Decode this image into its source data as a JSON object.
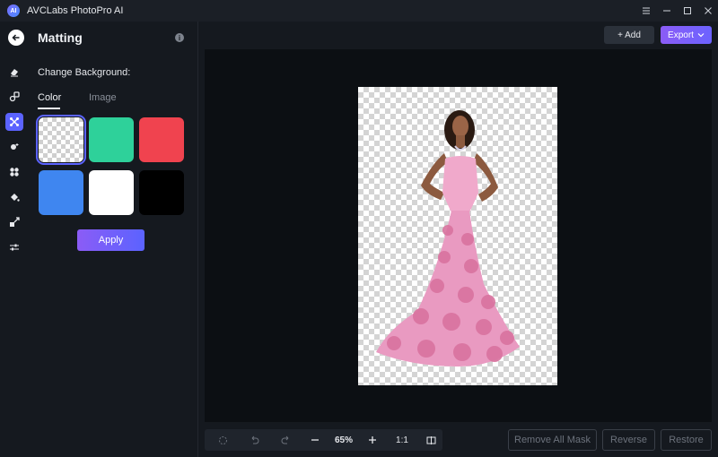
{
  "app": {
    "title": "AVCLabs PhotoPro AI",
    "logo_text": "AI"
  },
  "window_controls": [
    "menu-icon",
    "minimize-icon",
    "maximize-icon",
    "close-icon"
  ],
  "panel": {
    "title": "Matting",
    "info": "i",
    "change_bg_label": "Change Background:",
    "tabs": [
      {
        "label": "Color",
        "active": true
      },
      {
        "label": "Image",
        "active": false
      }
    ],
    "swatches": [
      {
        "name": "transparent",
        "color": "transparent",
        "selected": true
      },
      {
        "name": "green",
        "color": "#2ed19a",
        "selected": false
      },
      {
        "name": "red",
        "color": "#f0434f",
        "selected": false
      },
      {
        "name": "blue",
        "color": "#3f86f0",
        "selected": false
      },
      {
        "name": "white",
        "color": "#ffffff",
        "selected": false
      },
      {
        "name": "black",
        "color": "#000000",
        "selected": false
      }
    ],
    "apply_label": "Apply"
  },
  "rail": {
    "items": [
      "eraser-icon",
      "retouch-icon",
      "matting-icon",
      "enhance-icon",
      "effects-icon",
      "fill-icon",
      "resize-icon",
      "adjust-icon"
    ],
    "active": "matting-icon"
  },
  "topbar": {
    "add_label": "+ Add",
    "export_label": "Export"
  },
  "bottombar": {
    "zoom_level": "65%",
    "ratio_label": "1:1",
    "remove_all_mask": "Remove All Mask",
    "reverse": "Reverse",
    "restore": "Restore"
  },
  "colors": {
    "accent": "#5b63ff",
    "accent_gradient_start": "#8b5cf6",
    "bg": "#15191f",
    "canvas": "#0c0f13"
  }
}
